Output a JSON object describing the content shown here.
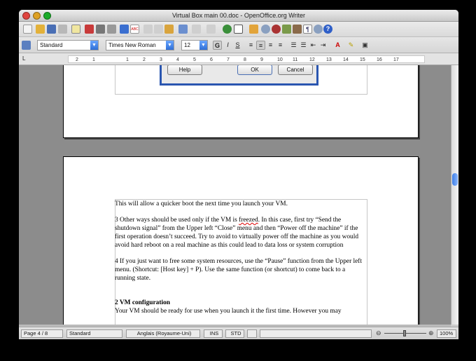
{
  "window": {
    "title": "Virtual Box main 00.doc - OpenOffice.org Writer"
  },
  "toolbar": {
    "icons": [
      "new-doc-icon",
      "open-icon",
      "save-icon",
      "email-icon",
      "edit-icon",
      "pdf-icon",
      "print-icon",
      "preview-icon",
      "spellcheck-icon",
      "autospell-icon",
      "cut-icon",
      "copy-icon",
      "paste-icon",
      "clone-icon",
      "undo-icon",
      "redo-icon",
      "hyperlink-icon",
      "table-icon",
      "show-draw-icon",
      "find-icon",
      "navigator-icon",
      "gallery-icon",
      "datasource-icon",
      "nonprinting-icon",
      "zoom-icon",
      "help-icon"
    ],
    "autospell_label": "ABC"
  },
  "format_bar": {
    "style_value": "Standard",
    "font_value": "Times New Roman",
    "size_value": "12",
    "bold_label": "G",
    "italic_label": "I",
    "underline_label": "S"
  },
  "ruler": {
    "ticks": [
      "L",
      "2",
      "1",
      "1",
      "2",
      "3",
      "4",
      "5",
      "6",
      "7",
      "8",
      "9",
      "10",
      "11",
      "12",
      "13",
      "14",
      "15",
      "16",
      "17"
    ]
  },
  "dialog": {
    "help_label": "Help",
    "ok_label": "OK",
    "cancel_label": "Cancel"
  },
  "document": {
    "para1": "This will allow a quicker boot the next time you launch your VM.",
    "para2_before": "3 Other ways should be used only if the VM is ",
    "para2_misspelled": "freezed",
    "para2_after": ". In this case, first try “Send the shutdown signal” from the Upper left “Close” menu and then “Power off the machine” if the first operation doesn’t succeed. Try to avoid to virtually power off the machine as you would avoid hard reboot on a real machine as this could lead to data loss or system corruption",
    "para3": "4 If you just want to free some system resources, use the “Pause” function from the Upper left menu. (Shortcut: [Host key] + P). Use the same function (or shortcut) to come back to a running state.",
    "heading": "2 VM configuration",
    "para4": "Your VM should be ready for use when you launch it the first time. However you may"
  },
  "statusbar": {
    "page": "Page 4 / 8",
    "style": "Standard",
    "language": "Anglais (Royaume-Uni)",
    "insert_mode": "INS",
    "selection_mode": "STD",
    "zoom": "100%"
  },
  "colors": {
    "dialog_border": "#2a56b0",
    "accent": "#2f6fd6"
  }
}
